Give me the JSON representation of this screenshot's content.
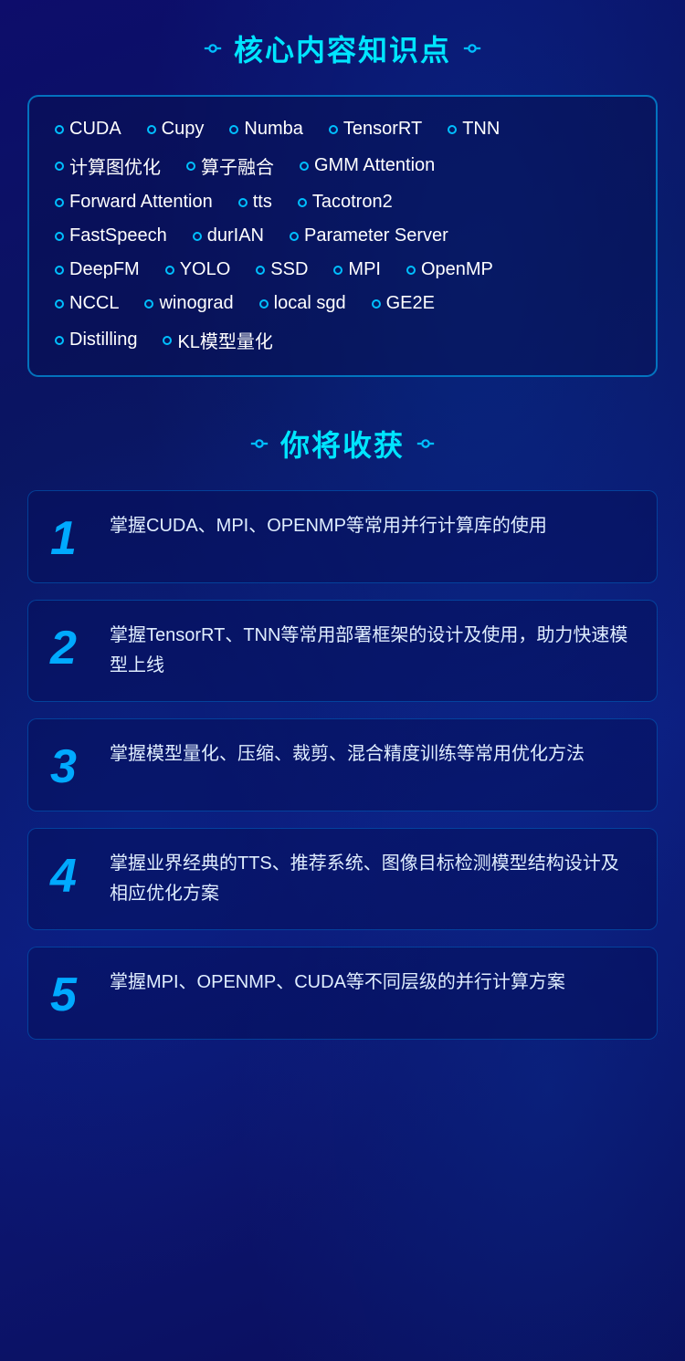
{
  "section1": {
    "title": "核心内容知识点",
    "deco_left": "◇",
    "deco_right": "◇"
  },
  "tags": [
    [
      {
        "label": "CUDA"
      },
      {
        "label": "Cupy"
      },
      {
        "label": "Numba"
      },
      {
        "label": "TensorRT"
      },
      {
        "label": "TNN"
      }
    ],
    [
      {
        "label": "计算图优化"
      },
      {
        "label": "算子融合"
      },
      {
        "label": "GMM Attention"
      }
    ],
    [
      {
        "label": "Forward Attention"
      },
      {
        "label": "tts"
      },
      {
        "label": "Tacotron2"
      }
    ],
    [
      {
        "label": "FastSpeech"
      },
      {
        "label": "durIAN"
      },
      {
        "label": "Parameter Server"
      }
    ],
    [
      {
        "label": "DeepFM"
      },
      {
        "label": "YOLO"
      },
      {
        "label": "SSD"
      },
      {
        "label": "MPI"
      },
      {
        "label": "OpenMP"
      }
    ],
    [
      {
        "label": "NCCL"
      },
      {
        "label": "winograd"
      },
      {
        "label": "local sgd"
      },
      {
        "label": "GE2E"
      }
    ],
    [
      {
        "label": "Distilling"
      },
      {
        "label": "KL模型量化"
      }
    ]
  ],
  "section2": {
    "title": "你将收获",
    "deco_left": "◇",
    "deco_right": "◇"
  },
  "benefits": [
    {
      "number": "1",
      "text": "掌握CUDA、MPI、OPENMP等常用并行计算库的使用"
    },
    {
      "number": "2",
      "text": "掌握TensorRT、TNN等常用部署框架的设计及使用，助力快速模型上线"
    },
    {
      "number": "3",
      "text": "掌握模型量化、压缩、裁剪、混合精度训练等常用优化方法"
    },
    {
      "number": "4",
      "text": "掌握业界经典的TTS、推荐系统、图像目标检测模型结构设计及相应优化方案"
    },
    {
      "number": "5",
      "text": "掌握MPI、OPENMP、CUDA等不同层级的并行计算方案"
    }
  ]
}
